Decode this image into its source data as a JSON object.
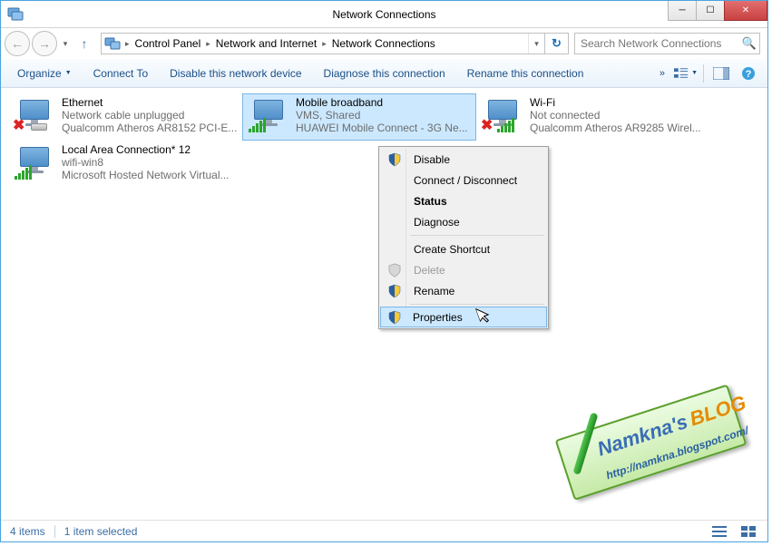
{
  "window": {
    "title": "Network Connections"
  },
  "breadcrumb": {
    "root_icon": "network-folder",
    "items": [
      "Control Panel",
      "Network and Internet",
      "Network Connections"
    ]
  },
  "search": {
    "placeholder": "Search Network Connections"
  },
  "toolbar": {
    "organize": "Organize",
    "connect_to": "Connect To",
    "disable": "Disable this network device",
    "diagnose": "Diagnose this connection",
    "rename": "Rename this connection"
  },
  "connections": [
    {
      "name": "Ethernet",
      "status": "Network cable unplugged",
      "device": "Qualcomm Atheros AR8152 PCI-E...",
      "icon": "ethernet-unplugged"
    },
    {
      "name": "Mobile broadband",
      "status": "VMS, Shared",
      "device": "HUAWEI Mobile Connect - 3G Ne...",
      "icon": "mobile-connected",
      "selected": true
    },
    {
      "name": "Wi-Fi",
      "status": "Not connected",
      "device": "Qualcomm Atheros AR9285 Wirel...",
      "icon": "wifi-disconnected"
    },
    {
      "name": "Local Area Connection* 12",
      "status": "wifi-win8",
      "device": "Microsoft Hosted Network Virtual...",
      "icon": "lan-virtual"
    }
  ],
  "context_menu": {
    "disable": "Disable",
    "connect": "Connect / Disconnect",
    "status": "Status",
    "diagnose": "Diagnose",
    "shortcut": "Create Shortcut",
    "delete": "Delete",
    "rename": "Rename",
    "properties": "Properties"
  },
  "statusbar": {
    "count": "4 items",
    "selected": "1 item selected"
  },
  "watermark": {
    "brand": "Namkna's",
    "brand2": "BLOG",
    "url": "http://namkna.blogspot.com/"
  }
}
